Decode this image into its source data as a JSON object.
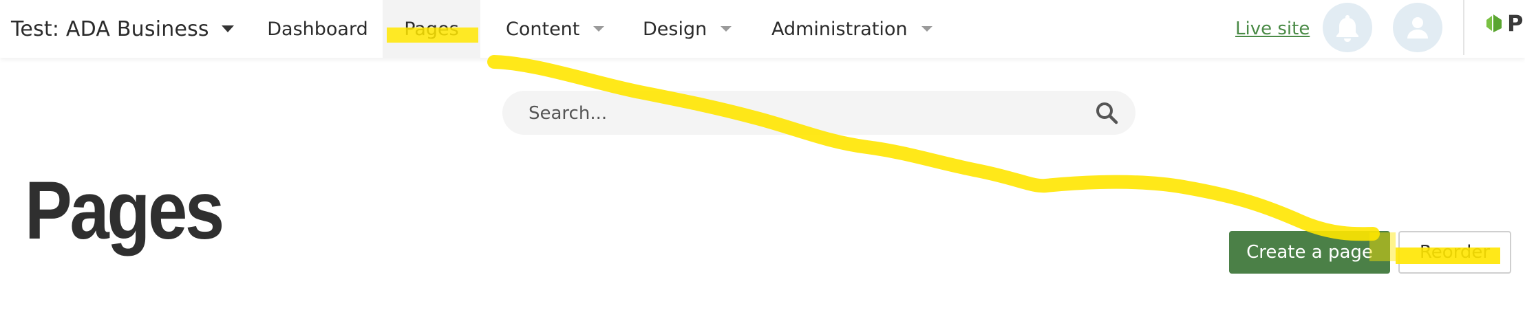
{
  "header": {
    "site_name": "Test: ADA Business",
    "nav": [
      {
        "label": "Dashboard",
        "has_dropdown": false,
        "active": false
      },
      {
        "label": "Pages",
        "has_dropdown": false,
        "active": true
      },
      {
        "label": "Content",
        "has_dropdown": true,
        "active": false
      },
      {
        "label": "Design",
        "has_dropdown": true,
        "active": false
      },
      {
        "label": "Administration",
        "has_dropdown": true,
        "active": false
      }
    ],
    "live_site_label": "Live site",
    "notifications_icon": "bell-icon",
    "user_icon": "user-icon",
    "brand_text": "P"
  },
  "search": {
    "placeholder": "Search...",
    "value": ""
  },
  "main": {
    "title": "Pages",
    "create_button_label": "Create a page",
    "reorder_button_label": "Reorder"
  },
  "colors": {
    "accent_green": "#4b8047",
    "live_site_link": "#4a8a46",
    "annotation_highlight": "#ffe600",
    "icon_circle": "#e2ecf3"
  }
}
